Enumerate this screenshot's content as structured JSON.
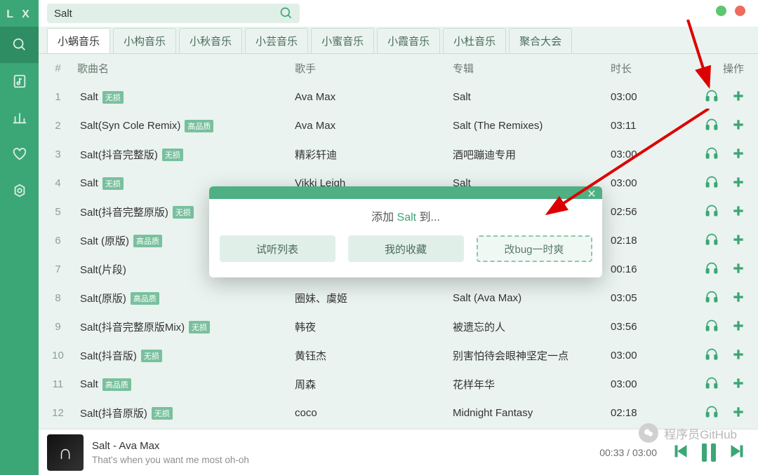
{
  "app": {
    "logo": "L X"
  },
  "search": {
    "value": "Salt",
    "placeholder": ""
  },
  "tabs": [
    {
      "label": "小蜗音乐",
      "active": true
    },
    {
      "label": "小构音乐"
    },
    {
      "label": "小秋音乐"
    },
    {
      "label": "小芸音乐"
    },
    {
      "label": "小蜜音乐"
    },
    {
      "label": "小霞音乐"
    },
    {
      "label": "小杜音乐"
    },
    {
      "label": "聚合大会"
    }
  ],
  "columns": {
    "idx": "#",
    "name": "歌曲名",
    "artist": "歌手",
    "album": "专辑",
    "length": "时长",
    "ops": "操作"
  },
  "rows": [
    {
      "idx": 1,
      "name": "Salt",
      "badge": "无损",
      "artist": "Ava Max",
      "album": "Salt",
      "length": "03:00"
    },
    {
      "idx": 2,
      "name": "Salt(Syn Cole Remix)",
      "badge": "高品质",
      "artist": "Ava Max",
      "album": "Salt (The Remixes)",
      "length": "03:11"
    },
    {
      "idx": 3,
      "name": "Salt(抖音完整版)",
      "badge": "无损",
      "artist": "精彩轩迪",
      "album": "酒吧蹦迪专用",
      "length": "03:00"
    },
    {
      "idx": 4,
      "name": "Salt",
      "badge": "无损",
      "artist": "Vikki Leigh",
      "album": "Salt",
      "length": "03:00"
    },
    {
      "idx": 5,
      "name": "Salt(抖音完整原版)",
      "badge": "无损",
      "artist": "",
      "album": "",
      "length": "02:56"
    },
    {
      "idx": 6,
      "name": "Salt (原版)",
      "badge": "高品质",
      "artist": "",
      "album": "",
      "length": "02:18"
    },
    {
      "idx": 7,
      "name": "Salt(片段)",
      "badge": "",
      "artist": "",
      "album": "",
      "length": "00:16"
    },
    {
      "idx": 8,
      "name": "Salt(原版)",
      "badge": "高品质",
      "artist": "圈妹、虞姬",
      "album": "Salt (Ava Max)",
      "length": "03:05"
    },
    {
      "idx": 9,
      "name": "Salt(抖音完整原版Mix)",
      "badge": "无损",
      "artist": "韩夜",
      "album": "被遗忘的人",
      "length": "03:56"
    },
    {
      "idx": 10,
      "name": "Salt(抖音版)",
      "badge": "无损",
      "artist": "黄钰杰",
      "album": "别害怕待会眼神坚定一点",
      "length": "03:00"
    },
    {
      "idx": 11,
      "name": "Salt",
      "badge": "高品质",
      "artist": "周森",
      "album": "花样年华",
      "length": "03:00"
    },
    {
      "idx": 12,
      "name": "Salt(抖音原版)",
      "badge": "无损",
      "artist": "coco",
      "album": "Midnight Fantasy",
      "length": "02:18"
    }
  ],
  "modal": {
    "prefix": "添加 ",
    "highlight": "Salt",
    "suffix": " 到...",
    "buttons": [
      {
        "label": "试听列表"
      },
      {
        "label": "我的收藏"
      },
      {
        "label": "改bug一时爽",
        "outlined": true
      }
    ]
  },
  "player": {
    "title": "Salt - Ava Max",
    "lyric": "That's when you want me most oh-oh",
    "elapsed": "00:33",
    "sep": " / ",
    "total": "03:00"
  },
  "watermark": {
    "text": "程序员GitHub"
  }
}
